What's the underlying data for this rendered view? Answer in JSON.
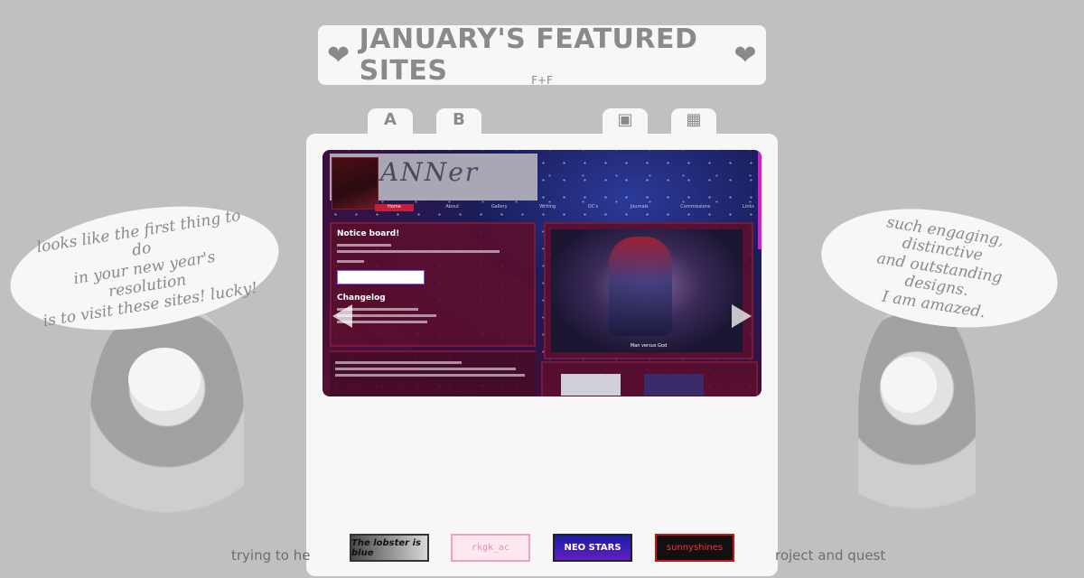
{
  "header": {
    "title": "JANUARY'S FEATURED SITES",
    "heart_left": "❤",
    "heart_right": "❤",
    "subtitle": "F+F"
  },
  "tabs": [
    {
      "label": "A"
    },
    {
      "label": "B"
    },
    {
      "label": "▣"
    },
    {
      "label": "▦"
    }
  ],
  "featured_screenshot": {
    "site_name": "ANNer",
    "nav_items": [
      "Home",
      "About",
      "Gallery",
      "Writing",
      "OC's",
      "Journals",
      "Commissions",
      "Links"
    ],
    "notice_title": "Notice board!",
    "changelog_title": "Changelog",
    "art_caption": "Man versus God"
  },
  "speech_left": "looks like the first thing to do\nin your new year's resolution\nis to visit these sites! lucky!",
  "speech_right": "such engaging, distinctive\nand outstanding designs.\nI am amazed.",
  "bottom": {
    "left_text": "trying to he",
    "right_text": "roject and quest"
  },
  "site_buttons": [
    {
      "label": "The lobster is blue"
    },
    {
      "label": "rkgk_ac"
    },
    {
      "label": "NEO STARS"
    },
    {
      "label": "sunnyshines"
    }
  ]
}
